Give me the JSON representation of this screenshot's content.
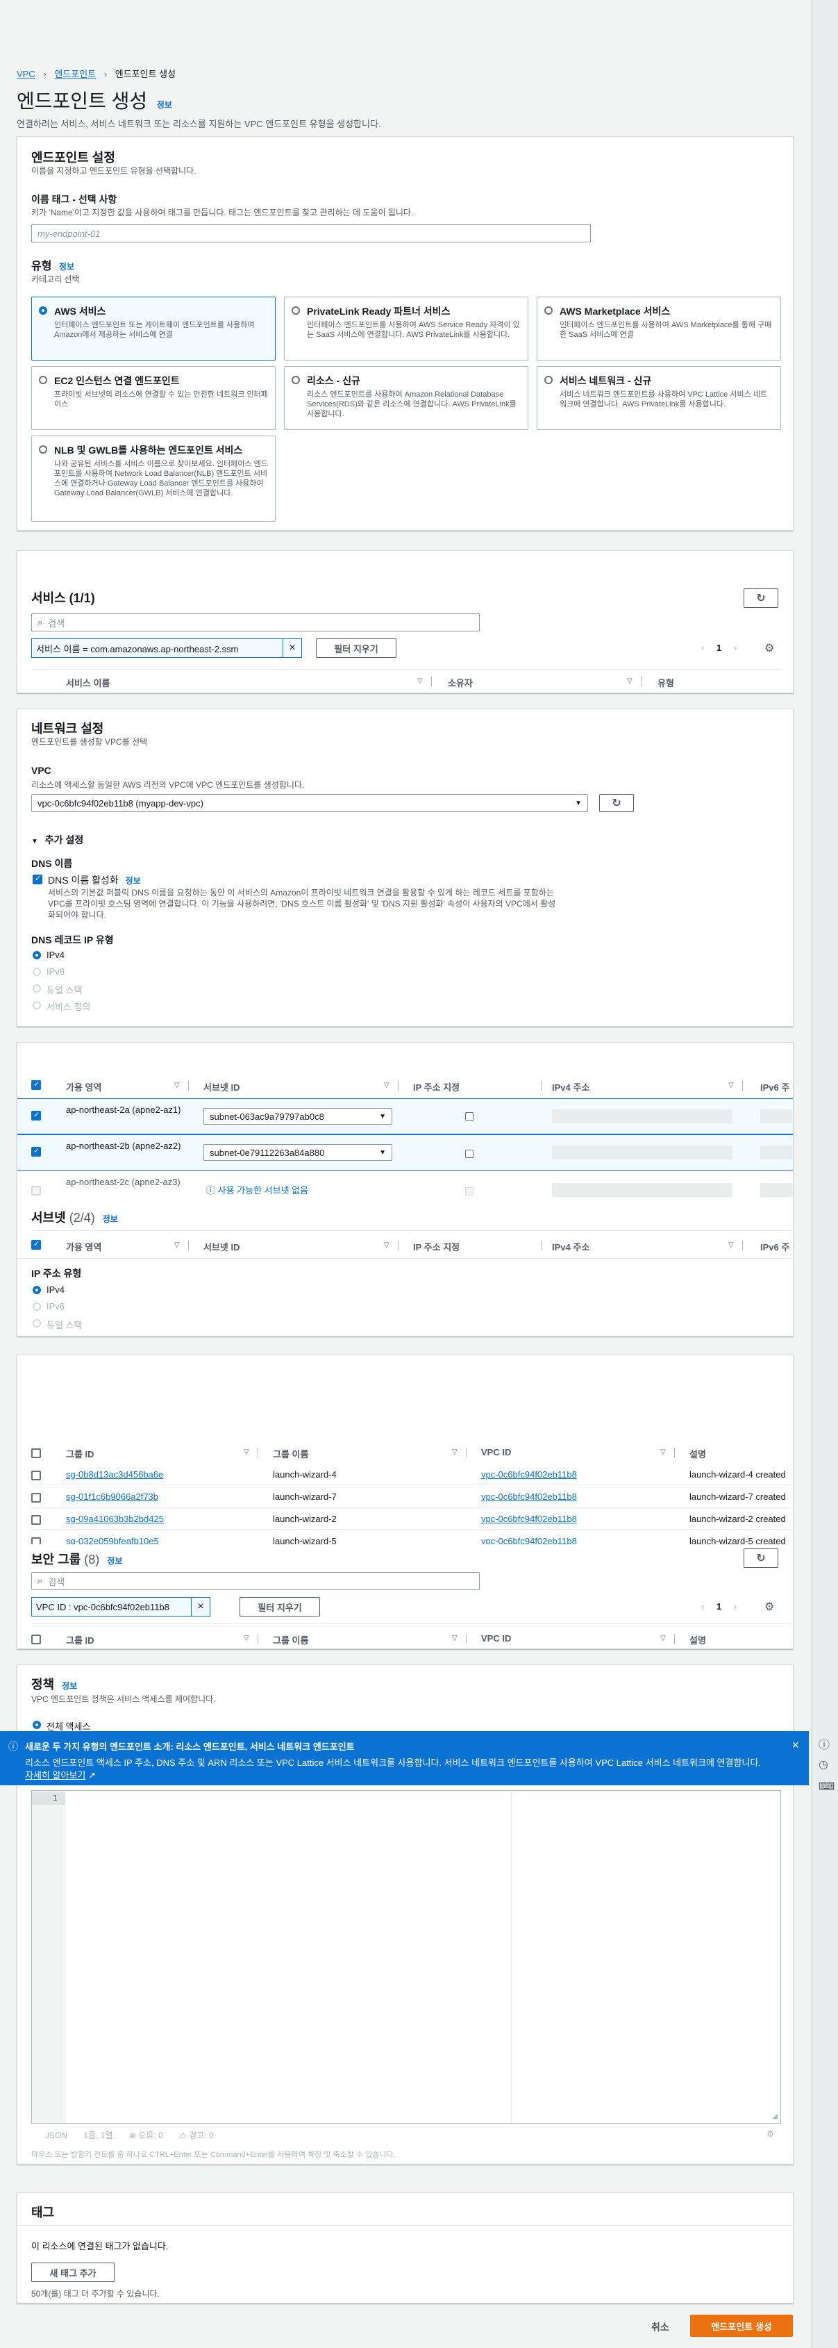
{
  "breadcrumb": [
    "VPC",
    "엔드포인트",
    "엔드포인트 생성"
  ],
  "page": {
    "title": "엔드포인트 생성",
    "info": "정보",
    "description": "연결하려는 서비스, 서비스 네트워크 또는 리소스를 지원하는 VPC 엔드포인트 유형을 생성합니다."
  },
  "endpoint_settings": {
    "title": "엔드포인트 설정",
    "description": "이름을 지정하고 엔드포인트 유형을 선택합니다.",
    "name_tag_label": "이름 태그 - 선택 사항",
    "name_tag_hint": "키가 'Name'이고 지정한 값을 사용하여 태그를 만듭니다. 태그는 엔드포인트를 찾고 관리하는 데 도움이 됩니다.",
    "name_tag_placeholder": "my-endpoint-01",
    "type_label": "유형",
    "type_info": "정보",
    "type_hint": "카테고리 선택",
    "types": [
      {
        "title": "AWS 서비스",
        "desc": "인터페이스 엔드포인트 또는 게이트웨이 엔드포인트를 사용하여 Amazon에서 제공하는 서비스에 연결"
      },
      {
        "title": "PrivateLink Ready 파트너 서비스",
        "desc": "인터페이스 엔드포인트를 사용하여 AWS Service Ready 자격이 있는 SaaS 서비스에 연결합니다. AWS PrivateLink를 사용합니다."
      },
      {
        "title": "AWS Marketplace 서비스",
        "desc": "인터페이스 엔드포인트를 사용하여 AWS Marketplace를 통해 구매한 SaaS 서비스에 연결"
      },
      {
        "title": "EC2 인스턴스 연결 엔드포인트",
        "desc": "프라이빗 서브넷의 리소스에 연결할 수 있는 안전한 네트워크 인터페이스"
      },
      {
        "title": "리소스 - 신규",
        "desc": "리소스 엔드포인트를 사용하여 Amazon Relational Database Services(RDS)와 같은 리소스에 연결합니다. AWS PrivateLink를 사용합니다."
      },
      {
        "title": "서비스 네트워크 - 신규",
        "desc": "서비스 네트워크 엔드포인트를 사용하여 VPC Lattice 서비스 네트워크에 연결합니다. AWS PrivateLink를 사용합니다."
      },
      {
        "title": "NLB 및 GWLB를 사용하는 엔드포인트 서비스",
        "desc": "나와 공유된 서비스를 서비스 이름으로 찾아보세요. 인터페이스 엔드포인트를 사용하여 Network Load Balancer(NLB) 엔드포인트 서비스에 연결하거나 Gateway Load Balancer 엔드포인트를 사용하여 Gateway Load Balancer(GWLB) 서비스에 연결합니다."
      }
    ]
  },
  "services": {
    "title": "서비스 (1/1)",
    "search_placeholder": "검색",
    "filter_token": "서비스 이름 = com.amazonaws.ap-northeast-2.ssm",
    "clear_filter": "필터 지우기",
    "page": "1",
    "columns": [
      "서비스 이름",
      "소유자",
      "유형"
    ]
  },
  "network": {
    "title": "네트워크 설정",
    "description": "엔드포인트를 생성할 VPC를 선택",
    "vpc_label": "VPC",
    "vpc_hint": "리소스에 액세스할 동일한 AWS 리전의 VPC에 VPC 엔드포인트를 생성합니다.",
    "vpc_value": "vpc-0c6bfc94f02eb11b8 (myapp-dev-vpc)",
    "additional": "추가 설정",
    "dns_name": "DNS 이름",
    "dns_enable": "DNS 이름 활성화",
    "dns_info": "정보",
    "dns_desc": "서비스의 기본값 퍼블릭 DNS 이름을 요청하는 동안 이 서비스의 Amazon이 프라이빗 네트워크 연결을 활용할 수 있게 하는 레코드 세트를 포함하는 VPC를 프라이빗 호스팅 영역에 연결합니다. 이 기능을 사용하려면, 'DNS 호스트 이름 활성화' 및 'DNS 지원 활성화' 속성이 사용자의 VPC에서 활성화되어야 합니다.",
    "record_ip_type": "DNS 레코드 IP 유형",
    "record_options": [
      "IPv4",
      "IPv6",
      "듀얼 스택",
      "서비스 정의"
    ]
  },
  "subnets": {
    "title": "서브넷",
    "count": "(2/4)",
    "info": "정보",
    "columns": [
      "가용 영역",
      "서브넷 ID",
      "IP 주소 지정",
      "IPv4 주소",
      "IPv6 주"
    ],
    "rows": [
      {
        "az": "ap-northeast-2a (apne2-az1)",
        "subnet": "subnet-063ac9a79797ab0c8"
      },
      {
        "az": "ap-northeast-2b (apne2-az2)",
        "subnet": "subnet-0e79112263a84a880"
      },
      {
        "az": "ap-northeast-2c (apne2-az3)",
        "subnet": "사용 가능한 서브넷 없음"
      }
    ],
    "ip_type_label": "IP 주소 유형",
    "ip_options": [
      "IPv4",
      "IPv6",
      "듀얼 스택"
    ]
  },
  "security_groups": {
    "title": "보안 그룹",
    "count": "(8)",
    "info": "정보",
    "search_placeholder": "검색",
    "filter_token": "VPC ID : vpc-0c6bfc94f02eb11b8",
    "clear_filter": "필터 지우기",
    "page": "1",
    "columns": [
      "그룹 ID",
      "그룹 이름",
      "VPC ID",
      "설명"
    ],
    "rows": [
      {
        "id": "sg-0b8d13ac3d456ba6e",
        "name": "launch-wizard-4",
        "vpc": "vpc-0c6bfc94f02eb11b8",
        "desc": "launch-wizard-4 created"
      },
      {
        "id": "sg-01f1c6b9066a2f73b",
        "name": "launch-wizard-7",
        "vpc": "vpc-0c6bfc94f02eb11b8",
        "desc": "launch-wizard-7 created"
      },
      {
        "id": "sg-09a41063b3b2bd425",
        "name": "launch-wizard-2",
        "vpc": "vpc-0c6bfc94f02eb11b8",
        "desc": "launch-wizard-2 created"
      },
      {
        "id": "sg-032e059bfeafb10e5",
        "name": "launch-wizard-5",
        "vpc": "vpc-0c6bfc94f02eb11b8",
        "desc": "launch-wizard-5 created"
      }
    ]
  },
  "policy": {
    "title": "정책",
    "info": "정보",
    "description": "VPC 엔드포인트 정책은 서비스 액세스를 제어합니다.",
    "option": "전체 액세스",
    "line_no": "1",
    "footer_json": "JSON",
    "footer_pos": "1줄, 1열",
    "footer_errors": "오류: 0",
    "footer_warnings": "경고: 0",
    "resize_hint": "마우스 또는 방향키 컨트롤 중 하나로 CTRL+Enter 또는 Command+Enter를 사용하여 확장 및 축소할 수 있습니다."
  },
  "banner": {
    "title": "새로운 두 가지 유형의 엔드포인트 소개: 리소스 엔드포인트, 서비스 네트워크 엔드포인트",
    "text": "리소스 엔드포인트 액세스 IP 주소, DNS 주소 및 ARN 리소스 또는 VPC Lattice 서비스 네트워크를 사용합니다. 서비스 네트워크 엔드포인트를 사용하여 VPC Lattice 서비스 네트워크에 연결합니다.",
    "link": "자세히 알아보기"
  },
  "tags": {
    "title": "태그",
    "empty": "이 리소스에 연결된 태그가 없습니다.",
    "add": "새 태그 추가",
    "limit": "50개(를) 태그 더 추가할 수 있습니다."
  },
  "footer": {
    "cancel": "취소",
    "create": "엔드포인트 생성"
  },
  "colors": {
    "accent": "#0972d3",
    "primary_button": "#ec7211",
    "banner": "#0972d3"
  }
}
